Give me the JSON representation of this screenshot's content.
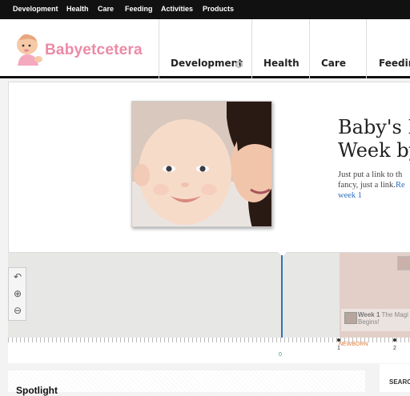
{
  "topbar": {
    "items": [
      "Development",
      "Health",
      "Care",
      "Feeding",
      "Activities",
      "Products"
    ]
  },
  "brand": {
    "name": "Babyetcetera",
    "color": "#ec8aa6"
  },
  "nav": {
    "items": [
      "Development",
      "Health",
      "Care",
      "Feeding"
    ]
  },
  "hero": {
    "title_line1": "Baby's L",
    "title_line2": "Week by",
    "text_line1": "Just put a link to th",
    "text_line2_prefix": "fancy, just a link.",
    "text_line2_link": "Re",
    "text_line3_link": "week 1"
  },
  "timeline": {
    "event_title_bold": "Week 1",
    "event_title_rest": " The Magi",
    "event_title_line2": "Begins!",
    "marker_label": "0",
    "label_newborn": "NEWBORN",
    "label_1": "1",
    "label_2": "2",
    "zoom_controls": [
      "back-icon",
      "zoom-in-icon",
      "zoom-out-icon"
    ]
  },
  "spotlight": {
    "title": "Spotlight"
  },
  "sidebar": {
    "search_label": "SEARC"
  },
  "colors": {
    "accent": "#2f72b7",
    "topbar": "#111111",
    "newborn": "#e07b3a"
  }
}
